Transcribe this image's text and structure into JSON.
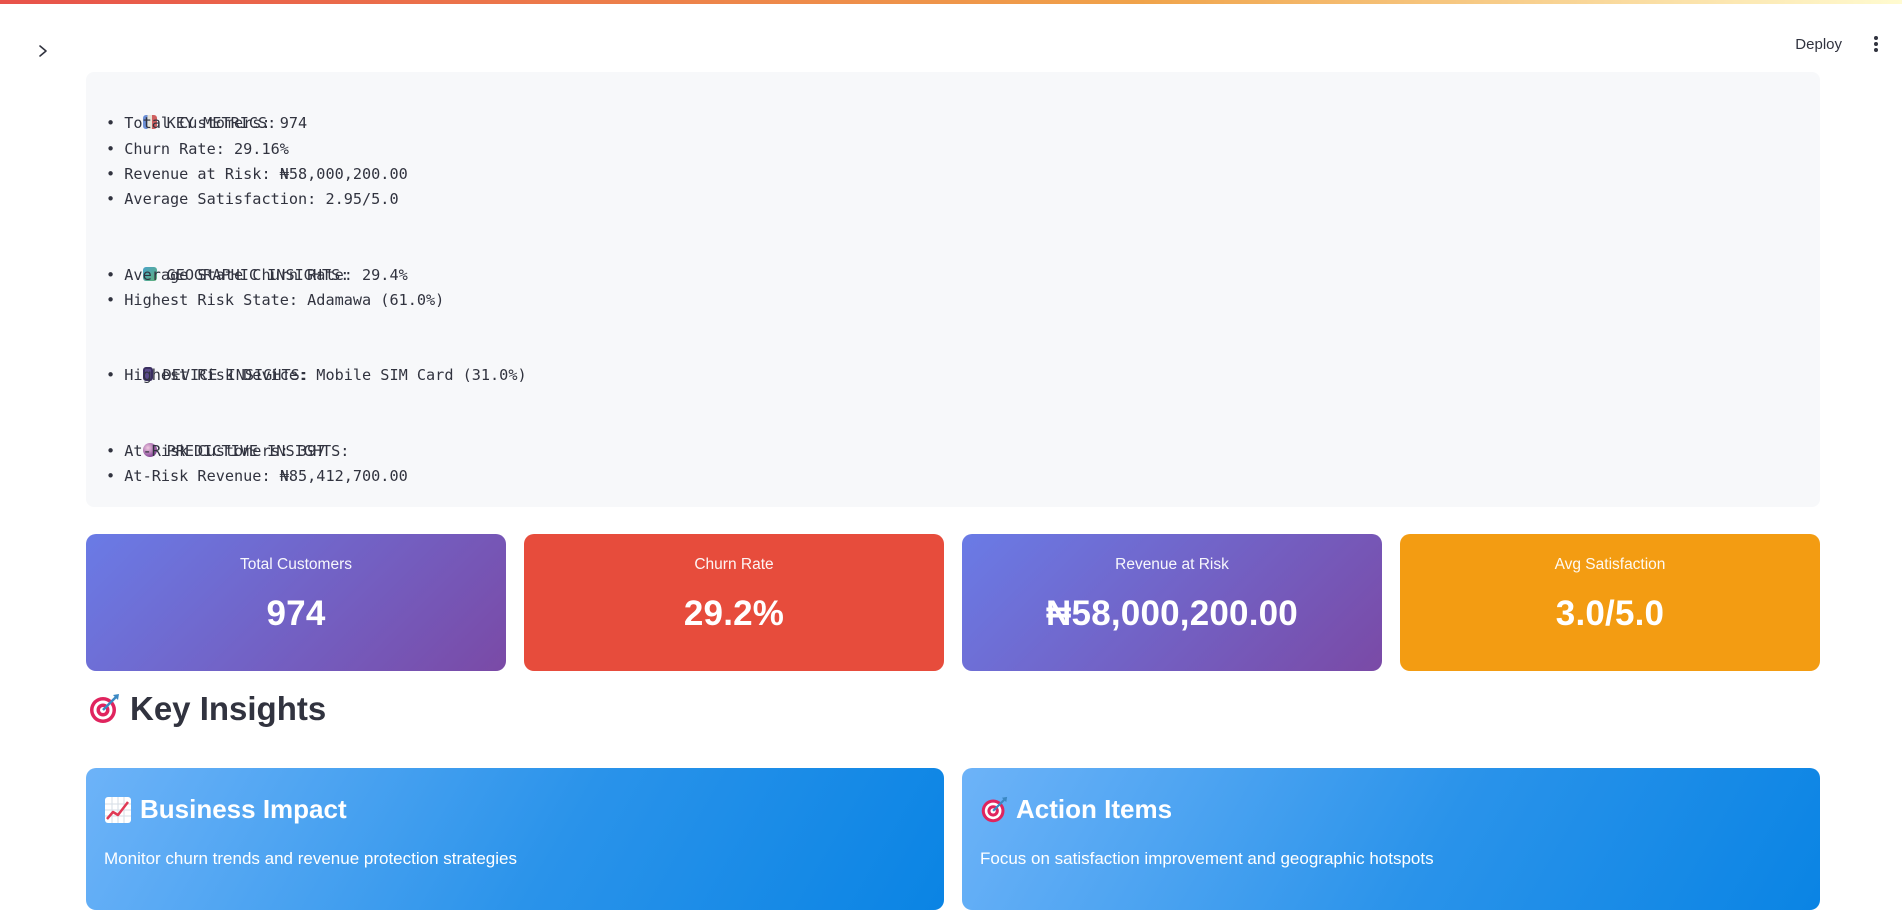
{
  "header": {
    "deploy_label": "Deploy",
    "sidebar_toggle_icon": "chevron-right-icon",
    "menu_icon": "vertical-ellipsis-icon"
  },
  "summary": {
    "key_metrics": {
      "icon": "bar-chart-icon",
      "heading": "KEY METRICS:",
      "lines": [
        "• Total Customers: 974",
        "• Churn Rate: 29.16%",
        "• Revenue at Risk: ₦58,000,200.00",
        "• Average Satisfaction: 2.95/5.0"
      ]
    },
    "geographic": {
      "icon": "map-icon",
      "heading": "GEOGRAPHIC INSIGHTS:",
      "lines": [
        "• Average State Churn Rate: 29.4%",
        "• Highest Risk State: Adamawa (61.0%)"
      ]
    },
    "device": {
      "icon": "mobile-phone-icon",
      "heading": "DEVICE INSIGHTS:",
      "lines": [
        "• Highest Risk Device: Mobile SIM Card (31.0%)"
      ]
    },
    "predictive": {
      "icon": "crystal-ball-icon",
      "heading": "PREDICTIVE INSIGHTS:",
      "lines": [
        "• At-Risk Customers: 397",
        "• At-Risk Revenue: ₦85,412,700.00"
      ]
    }
  },
  "metrics": [
    {
      "label": "Total Customers",
      "value": "974"
    },
    {
      "label": "Churn Rate",
      "value": "29.2%"
    },
    {
      "label": "Revenue at Risk",
      "value": "₦58,000,200.00"
    },
    {
      "label": "Avg Satisfaction",
      "value": "3.0/5.0"
    }
  ],
  "colors": {
    "purple_gradient": [
      "#6a7be6",
      "#7a4aa6"
    ],
    "red": "#e74c3c",
    "orange": "#f39c12",
    "blue_gradient": [
      "#6db3f8",
      "#0a84e4"
    ]
  },
  "insights": {
    "title": "Key Insights",
    "title_icon": "target-icon",
    "cards": [
      {
        "icon": "chart-increasing-icon",
        "title": "Business Impact",
        "text": "Monitor churn trends and revenue protection strategies"
      },
      {
        "icon": "target-icon",
        "title": "Action Items",
        "text": "Focus on satisfaction improvement and geographic hotspots"
      }
    ]
  }
}
